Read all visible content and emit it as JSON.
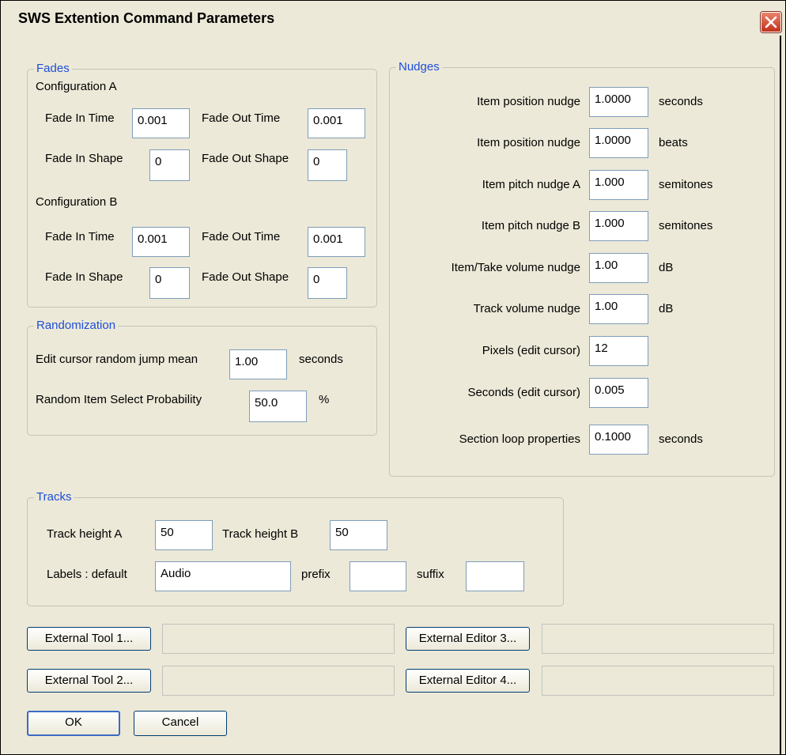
{
  "window": {
    "title": "SWS Extention Command Parameters"
  },
  "fades": {
    "legend": "Fades",
    "config_a": "Configuration A",
    "config_b": "Configuration B",
    "fade_in_time_label": "Fade In Time",
    "fade_out_time_label": "Fade Out Time",
    "fade_in_shape_label": "Fade In Shape",
    "fade_out_shape_label": "Fade Out Shape",
    "a": {
      "fade_in_time": "0.001",
      "fade_out_time": "0.001",
      "fade_in_shape": "0",
      "fade_out_shape": "0"
    },
    "b": {
      "fade_in_time": "0.001",
      "fade_out_time": "0.001",
      "fade_in_shape": "0",
      "fade_out_shape": "0"
    }
  },
  "randomization": {
    "legend": "Randomization",
    "jump_label": "Edit cursor random jump mean",
    "jump_value": "1.00",
    "jump_unit": "seconds",
    "prob_label": "Random Item Select Probability",
    "prob_value": "50.0",
    "prob_unit": "%"
  },
  "nudges": {
    "legend": "Nudges",
    "rows": [
      {
        "label": "Item position nudge",
        "value": "1.0000",
        "unit": "seconds"
      },
      {
        "label": "Item position nudge",
        "value": "1.0000",
        "unit": "beats"
      },
      {
        "label": "Item pitch nudge A",
        "value": "1.000",
        "unit": "semitones"
      },
      {
        "label": "Item pitch nudge B",
        "value": "1.000",
        "unit": "semitones"
      },
      {
        "label": "Item/Take volume nudge",
        "value": "1.00",
        "unit": "dB"
      },
      {
        "label": "Track volume nudge",
        "value": "1.00",
        "unit": "dB"
      },
      {
        "label": "Pixels (edit cursor)",
        "value": "12",
        "unit": ""
      },
      {
        "label": "Seconds (edit cursor)",
        "value": "0.005",
        "unit": ""
      },
      {
        "label": "Section loop properties",
        "value": "0.1000",
        "unit": "seconds"
      }
    ]
  },
  "tracks": {
    "legend": "Tracks",
    "height_a_label": "Track height A",
    "height_a_value": "50",
    "height_b_label": "Track height B",
    "height_b_value": "50",
    "labels_default_label": "Labels : default",
    "labels_default_value": "Audio",
    "prefix_label": "prefix",
    "prefix_value": "",
    "suffix_label": "suffix",
    "suffix_value": ""
  },
  "external": {
    "tool1": "External Tool 1...",
    "tool2": "External Tool 2...",
    "editor3": "External Editor 3...",
    "editor4": "External Editor 4..."
  },
  "buttons": {
    "ok": "OK",
    "cancel": "Cancel"
  },
  "icons": {
    "close": "close-icon"
  },
  "colors": {
    "legend_text": "#1e4ed8",
    "dialog_bg": "#ece9d8",
    "close_button": "#c1311a"
  }
}
